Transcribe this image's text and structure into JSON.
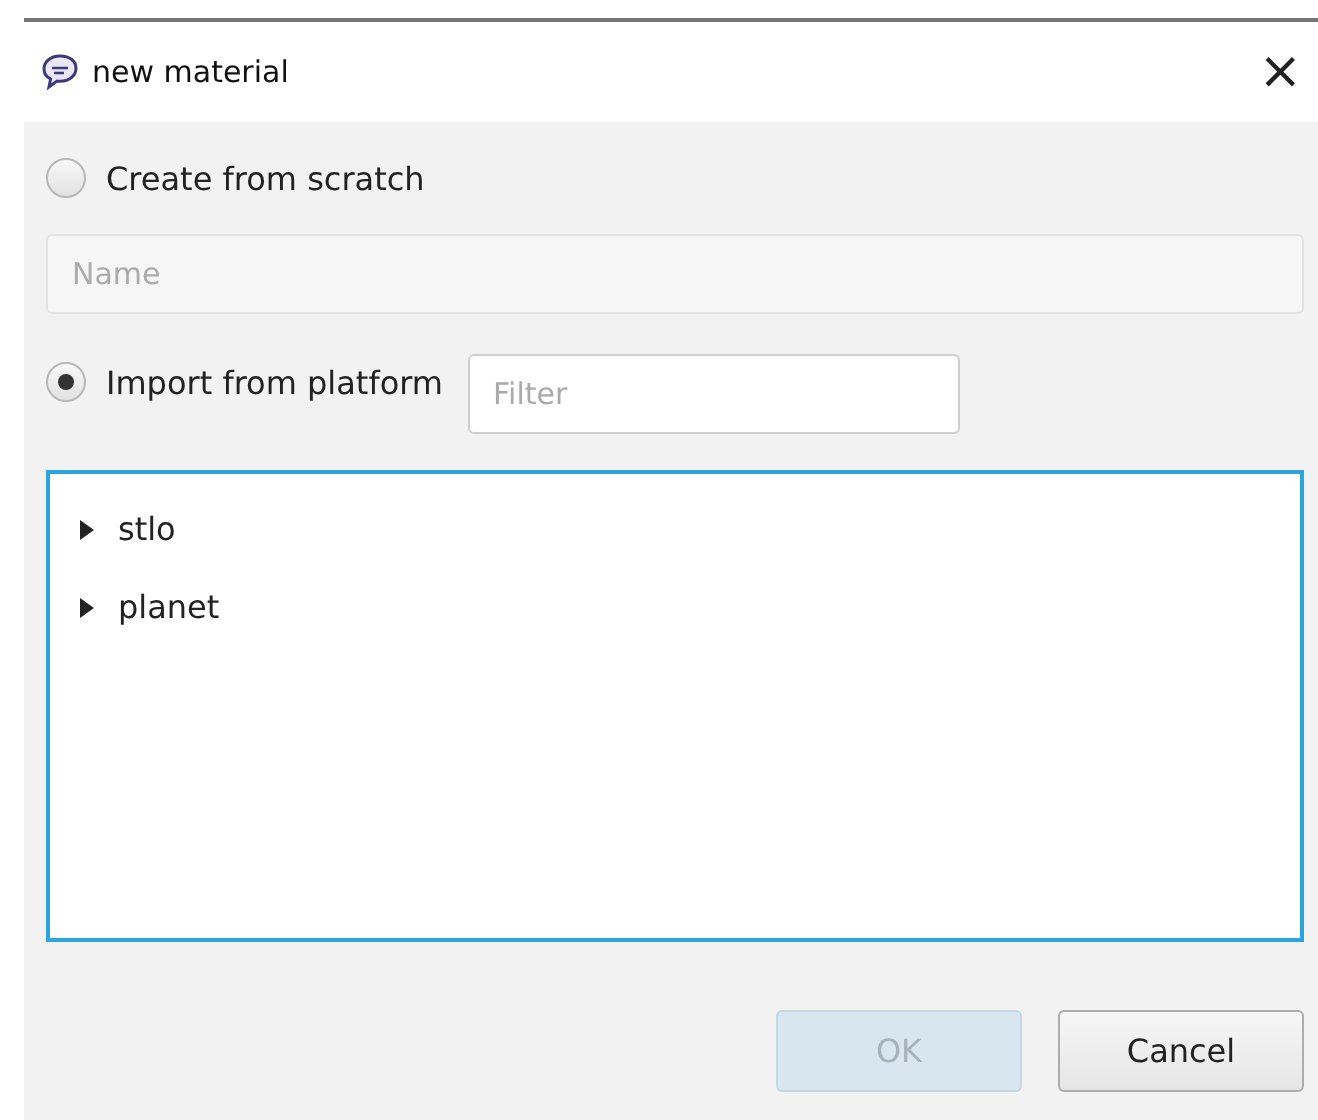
{
  "window": {
    "title": "new material",
    "close": "×"
  },
  "options": [
    {
      "label": "Create from scratch",
      "selected": false
    },
    {
      "label": "Import from platform",
      "selected": true
    }
  ],
  "name_field": {
    "placeholder": "Name",
    "disabled": true
  },
  "filter_field": {
    "placeholder": "Filter"
  },
  "tree": {
    "items": [
      {
        "label": "stlo",
        "expanded": false
      },
      {
        "label": "planet",
        "expanded": false
      }
    ]
  },
  "buttons": [
    {
      "label": "OK",
      "disabled": true
    },
    {
      "label": "Cancel",
      "disabled": false
    }
  ]
}
